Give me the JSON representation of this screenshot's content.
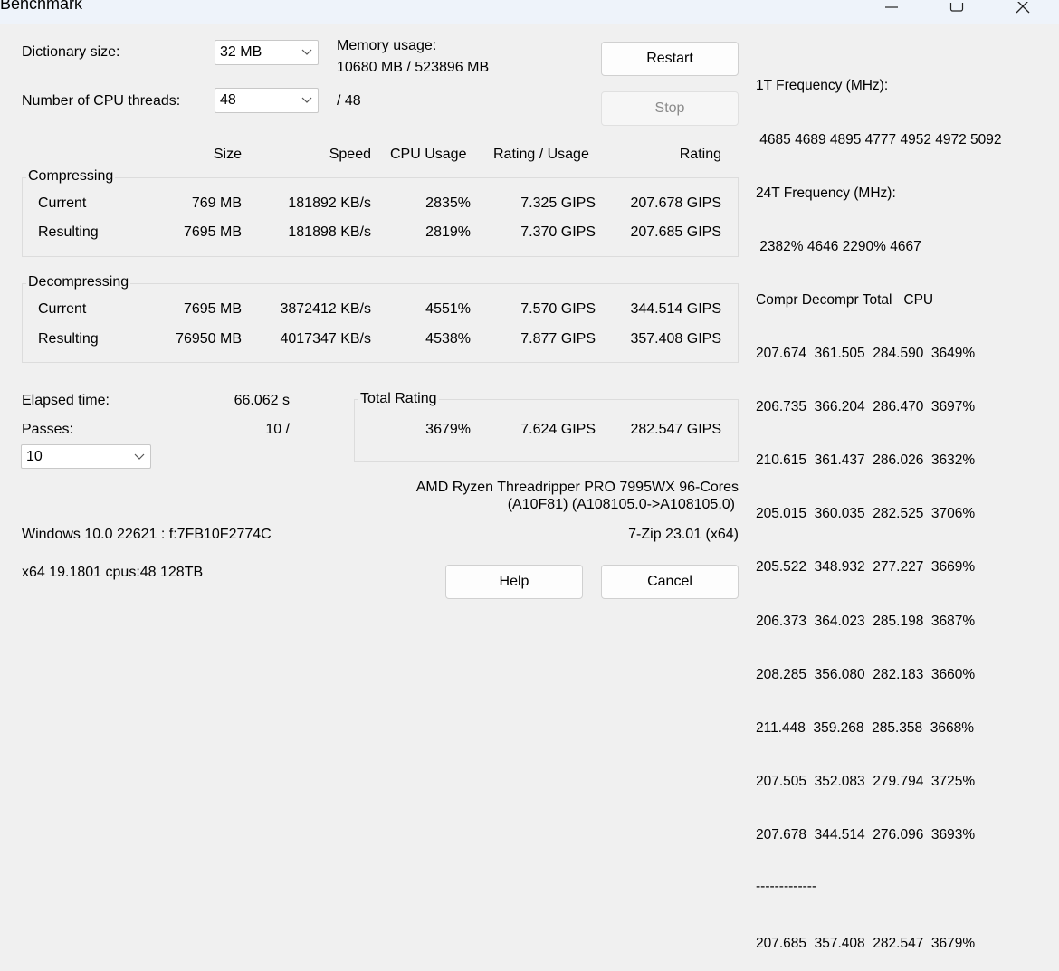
{
  "window": {
    "title": "Benchmark"
  },
  "settings": {
    "dict_label": "Dictionary size:",
    "dict_value": "32 MB",
    "threads_label": "Number of CPU threads:",
    "threads_value": "48",
    "threads_max": "/ 48",
    "memory_label": "Memory usage:",
    "memory_value": "10680 MB / 523896 MB"
  },
  "buttons": {
    "restart": "Restart",
    "stop": "Stop",
    "help": "Help",
    "cancel": "Cancel"
  },
  "columns": {
    "size": "Size",
    "speed": "Speed",
    "cpu": "CPU Usage",
    "rating_usage": "Rating / Usage",
    "rating": "Rating"
  },
  "compress": {
    "label": "Compressing",
    "current": {
      "label": "Current",
      "size": "769 MB",
      "speed": "181892 KB/s",
      "cpu": "2835%",
      "ru": "7.325 GIPS",
      "rating": "207.678 GIPS"
    },
    "resulting": {
      "label": "Resulting",
      "size": "7695 MB",
      "speed": "181898 KB/s",
      "cpu": "2819%",
      "ru": "7.370 GIPS",
      "rating": "207.685 GIPS"
    }
  },
  "decompress": {
    "label": "Decompressing",
    "current": {
      "label": "Current",
      "size": "7695 MB",
      "speed": "3872412 KB/s",
      "cpu": "4551%",
      "ru": "7.570 GIPS",
      "rating": "344.514 GIPS"
    },
    "resulting": {
      "label": "Resulting",
      "size": "76950 MB",
      "speed": "4017347 KB/s",
      "cpu": "4538%",
      "ru": "7.877 GIPS",
      "rating": "357.408 GIPS"
    }
  },
  "stats": {
    "elapsed_label": "Elapsed time:",
    "elapsed_value": "66.062 s",
    "passes_label": "Passes:",
    "passes_value": "10 /",
    "passes_select": "10"
  },
  "total": {
    "label": "Total Rating",
    "cpu": "3679%",
    "ru": "7.624 GIPS",
    "rating": "282.547 GIPS"
  },
  "cpu_info": {
    "line1": "AMD Ryzen Threadripper PRO 7995WX 96-Cores",
    "line2": "(A10F81) (A108105.0->A108105.0)"
  },
  "sys": {
    "os": "Windows 10.0 22621 : f:7FB10F2774C",
    "version": "7-Zip 23.01 (x64)",
    "arch": "x64 19.1801 cpus:48 128TB"
  },
  "log": {
    "lines": [
      "1T Frequency (MHz):",
      " 4685 4689 4895 4777 4952 4972 5092",
      "24T Frequency (MHz):",
      " 2382% 4646 2290% 4667",
      "Compr Decompr Total   CPU",
      "207.674  361.505  284.590  3649%",
      "206.735  366.204  286.470  3697%",
      "210.615  361.437  286.026  3632%",
      "205.015  360.035  282.525  3706%",
      "205.522  348.932  277.227  3669%",
      "206.373  364.023  285.198  3687%",
      "208.285  356.080  282.183  3660%",
      "211.448  359.268  285.358  3668%",
      "207.505  352.083  279.794  3725%",
      "207.678  344.514  276.096  3693%",
      "-------------",
      "207.685  357.408  282.547  3679%"
    ]
  }
}
